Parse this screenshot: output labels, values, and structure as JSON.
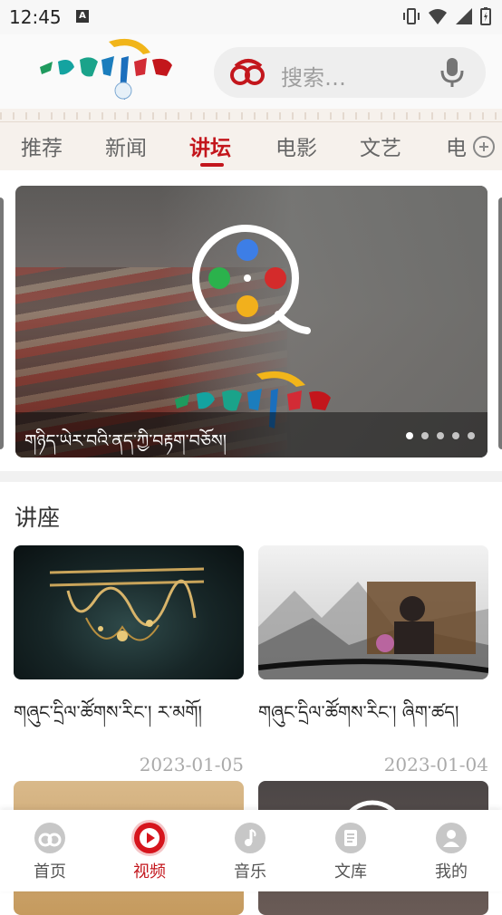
{
  "status_bar": {
    "time": "12:45",
    "notification_badge": "A"
  },
  "header": {
    "search_placeholder": "搜索…"
  },
  "tabs": [
    {
      "label": "推荐"
    },
    {
      "label": "新闻"
    },
    {
      "label": "讲坛"
    },
    {
      "label": "电影"
    },
    {
      "label": "文艺"
    },
    {
      "label": "电"
    }
  ],
  "active_tab": "讲坛",
  "banner": {
    "caption": "གཉིད་ཡེར་བའི་ནད་ཀྱི་བརྟག་བཅོས།",
    "slide_count": 5,
    "active_slide": 1
  },
  "section": {
    "title": "讲座",
    "cards": [
      {
        "title": "གཞུང་དྲིལ་ཚོགས་རིང་། ར་མགོ།",
        "date": "2023-01-05"
      },
      {
        "title": "གཞུང་དྲིལ་ཚོགས་རིང་། ཞིག་ཚད།",
        "date": "2023-01-04"
      }
    ]
  },
  "bottom_nav": [
    {
      "label": "首页",
      "icon": "home-logo-icon"
    },
    {
      "label": "视频",
      "icon": "play-icon"
    },
    {
      "label": "音乐",
      "icon": "music-note-icon"
    },
    {
      "label": "文库",
      "icon": "document-icon"
    },
    {
      "label": "我的",
      "icon": "user-icon"
    }
  ],
  "colors": {
    "accent": "#c3161c",
    "tab_background": "#f6f1ec",
    "inactive_icon": "#c7c7c7"
  }
}
